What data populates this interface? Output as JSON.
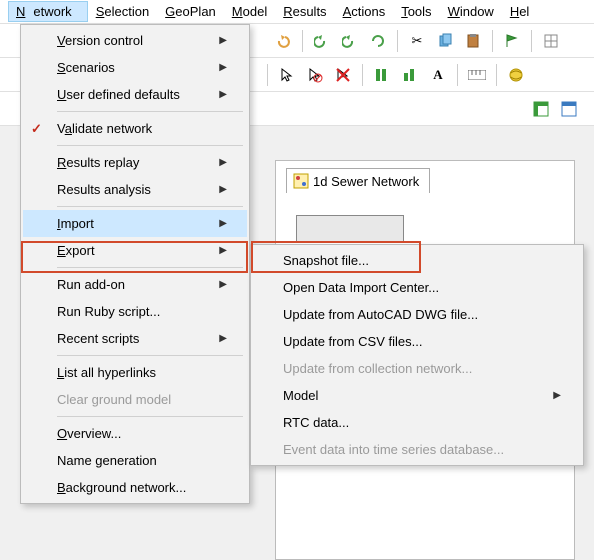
{
  "menubar": {
    "items": [
      "Network",
      "Selection",
      "GeoPlan",
      "Model",
      "Results",
      "Actions",
      "Tools",
      "Window",
      "Help"
    ],
    "active_index": 0
  },
  "tab": {
    "label": "1d Sewer Network"
  },
  "network_menu": {
    "items": [
      {
        "label": "Version control",
        "submenu": true,
        "u": 0
      },
      {
        "label": "Scenarios",
        "submenu": true,
        "u": 0
      },
      {
        "label": "User defined defaults",
        "submenu": true,
        "u": 0
      },
      {
        "sep": true
      },
      {
        "label": "Validate network",
        "check": true,
        "u": 0
      },
      {
        "sep": true
      },
      {
        "label": "Results replay",
        "submenu": true,
        "u": 0
      },
      {
        "label": "Results analysis",
        "submenu": true
      },
      {
        "sep": true
      },
      {
        "label": "Import",
        "submenu": true,
        "hl": true,
        "u": 0
      },
      {
        "label": "Export",
        "submenu": true,
        "u": 0
      },
      {
        "sep": true
      },
      {
        "label": "Run add-on",
        "submenu": true
      },
      {
        "label": "Run Ruby script..."
      },
      {
        "label": "Recent scripts",
        "submenu": true
      },
      {
        "sep": true
      },
      {
        "label": "List all hyperlinks",
        "u": 0
      },
      {
        "label": "Clear ground model",
        "disabled": true
      },
      {
        "sep": true
      },
      {
        "label": "Overview...",
        "u": 0
      },
      {
        "label": "Name generation"
      },
      {
        "label": "Background network...",
        "u": 0
      }
    ]
  },
  "import_submenu": {
    "items": [
      {
        "label": "Snapshot file...",
        "hl": true
      },
      {
        "label": "Open Data Import Center..."
      },
      {
        "label": "Update from AutoCAD DWG file..."
      },
      {
        "label": "Update from CSV files..."
      },
      {
        "label": "Update from collection network...",
        "disabled": true
      },
      {
        "label": "Model",
        "submenu": true
      },
      {
        "label": "RTC data..."
      },
      {
        "label": "Event data into time series database...",
        "disabled": true
      }
    ]
  }
}
